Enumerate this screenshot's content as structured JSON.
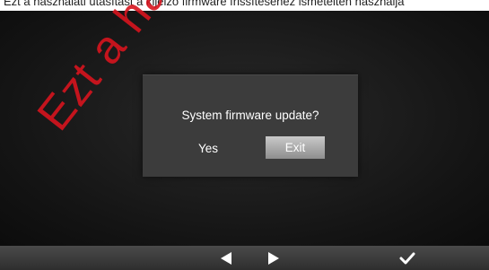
{
  "top_strip": {
    "text": "Ezt a használati utasítást a kijelző firmware frissítéséhez ismételten használja"
  },
  "dialog": {
    "title": "System firmware update?",
    "yes_label": "Yes",
    "exit_label": "Exit"
  },
  "watermark": {
    "text": "Ezt a haszná"
  },
  "bottom_bar": {
    "left_icon": "left-arrow-icon",
    "right_icon": "right-arrow-icon",
    "confirm_icon": "checkmark-icon"
  },
  "colors": {
    "dialog_bg": "#3c3c3c",
    "selected_button": "#b0b0b0",
    "watermark": "#d7141e"
  }
}
